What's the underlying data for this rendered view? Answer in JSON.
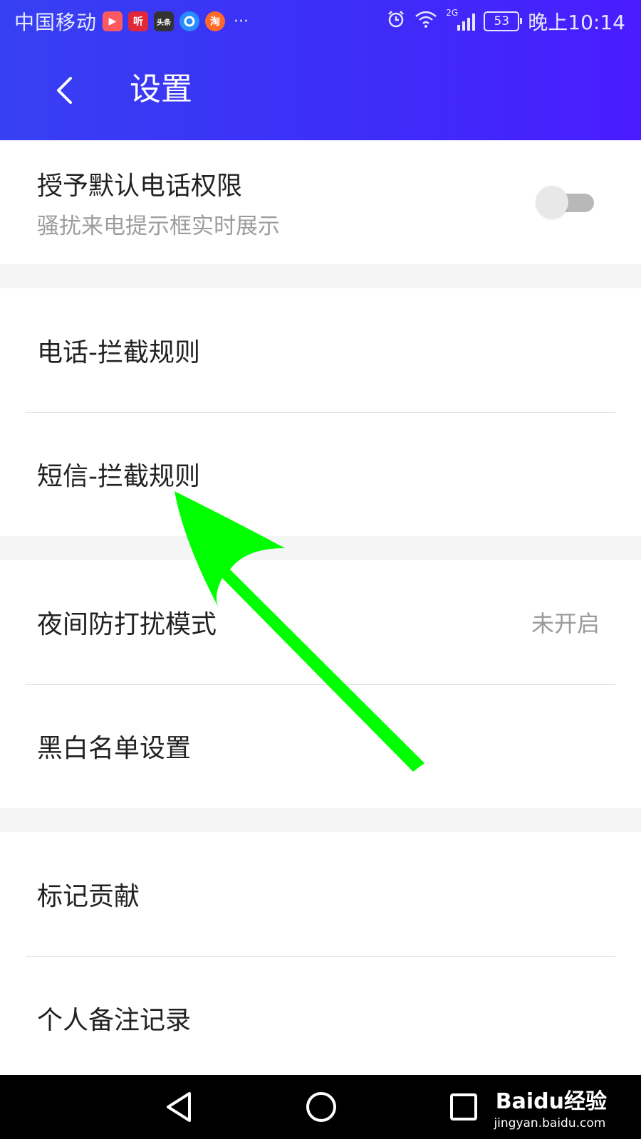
{
  "status_bar": {
    "carrier": "中国移动",
    "app_icons": [
      {
        "icon": "video-app-icon",
        "label": "▶"
      },
      {
        "icon": "listen-app-icon",
        "label": "听"
      },
      {
        "icon": "toutiao-app-icon",
        "label": "头条"
      },
      {
        "icon": "browser-app-icon",
        "label": ""
      },
      {
        "icon": "taobao-app-icon",
        "label": "淘"
      }
    ],
    "more": "···",
    "network": "2G",
    "battery": "53",
    "time": "晚上10:14"
  },
  "header": {
    "title": "设置"
  },
  "sections": [
    {
      "items": [
        {
          "label": "授予默认电话权限",
          "sublabel": "骚扰来电提示框实时展示",
          "toggle_on": false
        }
      ]
    },
    {
      "items": [
        {
          "label": "电话-拦截规则"
        },
        {
          "label": "短信-拦截规则"
        }
      ]
    },
    {
      "items": [
        {
          "label": "夜间防打扰模式",
          "value": "未开启"
        },
        {
          "label": "黑白名单设置"
        }
      ]
    },
    {
      "items": [
        {
          "label": "标记贡献"
        },
        {
          "label": "个人备注记录"
        }
      ]
    }
  ],
  "watermark": {
    "logo": "Baidu经验",
    "url": "jingyan.baidu.com"
  },
  "colors": {
    "header_start": "#3740f2",
    "header_end": "#4a1cff",
    "annotation_arrow": "#00ff00"
  }
}
